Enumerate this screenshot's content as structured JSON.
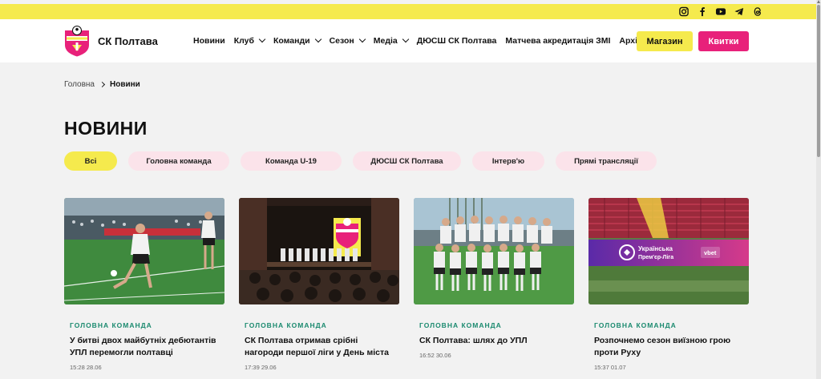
{
  "social": {
    "icons": [
      "instagram-icon",
      "facebook-icon",
      "youtube-icon",
      "telegram-icon",
      "threads-icon"
    ]
  },
  "header": {
    "club_name": "СК Полтава",
    "logo_text": "ПОЛТАВА",
    "nav": [
      {
        "label": "Новини",
        "dropdown": false
      },
      {
        "label": "Клуб",
        "dropdown": true
      },
      {
        "label": "Команди",
        "dropdown": true
      },
      {
        "label": "Сезон",
        "dropdown": true
      },
      {
        "label": "Медіа",
        "dropdown": true
      },
      {
        "label": "ДЮСШ СК Полтава",
        "dropdown": false
      },
      {
        "label": "Матчева акредитація ЗМІ",
        "dropdown": false
      },
      {
        "label": "Архів",
        "dropdown": false
      }
    ],
    "shop_label": "Магазин",
    "tickets_label": "Квитки"
  },
  "breadcrumb": {
    "home": "Головна",
    "current": "Новини"
  },
  "page": {
    "title": "НОВИНИ"
  },
  "filters": [
    {
      "label": "Всі",
      "active": true
    },
    {
      "label": "Головна команда",
      "active": false
    },
    {
      "label": "Команда U-19",
      "active": false
    },
    {
      "label": "ДЮСШ СК Полтава",
      "active": false
    },
    {
      "label": "Інтерв'ю",
      "active": false
    },
    {
      "label": "Прямі трансляції",
      "active": false
    }
  ],
  "news": [
    {
      "category": "ГОЛОВНА КОМАНДА",
      "title": "У битві двох майбутніх дебютантів УПЛ перемогли полтавці",
      "date": "15:28 28.06"
    },
    {
      "category": "ГОЛОВНА КОМАНДА",
      "title": "СК Полтава отримав срібні нагороди першої ліги у День міста",
      "date": "17:39 29.06"
    },
    {
      "category": "ГОЛОВНА КОМАНДА",
      "title": "СК Полтава: шлях до УПЛ",
      "date": "16:52 30.06"
    },
    {
      "category": "ГОЛОВНА КОМАНДА",
      "title": "Розпочнемо сезон виїзною грою проти Руху",
      "date": "15:37 01.07"
    }
  ],
  "banner": {
    "league_line1": "Українська",
    "league_line2": "Прем'єр-Ліга",
    "sponsor": "vbet"
  },
  "colors": {
    "accent_yellow": "#f5ea4d",
    "accent_pink": "#e8217a",
    "category_green": "#1b8a6f",
    "chip_pink": "#fbe3ea"
  }
}
